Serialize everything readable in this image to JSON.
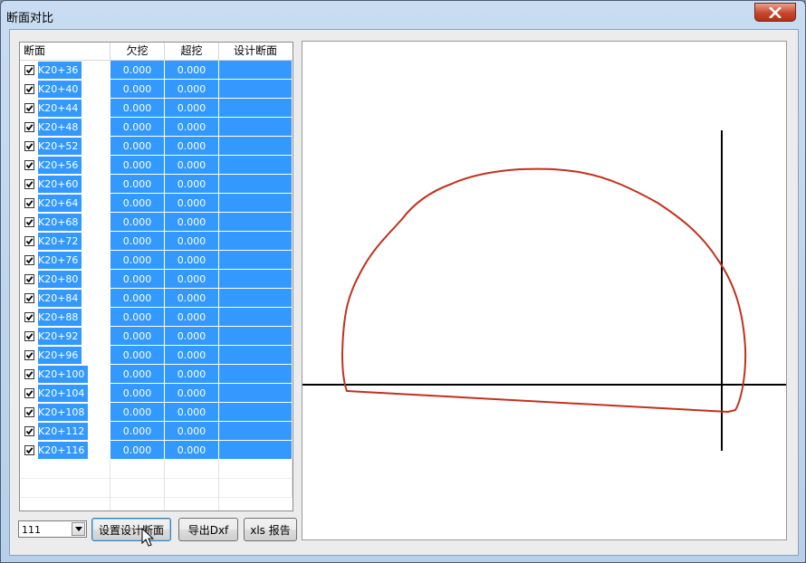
{
  "window": {
    "title": "断面对比"
  },
  "table": {
    "headers": [
      "断面",
      "欠挖",
      "超挖",
      "设计断面"
    ],
    "rows": [
      {
        "station": "K20+36",
        "under": "0.000",
        "over": "0.000",
        "design": "",
        "checked": true
      },
      {
        "station": "K20+40",
        "under": "0.000",
        "over": "0.000",
        "design": "",
        "checked": true
      },
      {
        "station": "K20+44",
        "under": "0.000",
        "over": "0.000",
        "design": "",
        "checked": true
      },
      {
        "station": "K20+48",
        "under": "0.000",
        "over": "0.000",
        "design": "",
        "checked": true
      },
      {
        "station": "K20+52",
        "under": "0.000",
        "over": "0.000",
        "design": "",
        "checked": true
      },
      {
        "station": "K20+56",
        "under": "0.000",
        "over": "0.000",
        "design": "",
        "checked": true
      },
      {
        "station": "K20+60",
        "under": "0.000",
        "over": "0.000",
        "design": "",
        "checked": true
      },
      {
        "station": "K20+64",
        "under": "0.000",
        "over": "0.000",
        "design": "",
        "checked": true
      },
      {
        "station": "K20+68",
        "under": "0.000",
        "over": "0.000",
        "design": "",
        "checked": true
      },
      {
        "station": "K20+72",
        "under": "0.000",
        "over": "0.000",
        "design": "",
        "checked": true
      },
      {
        "station": "K20+76",
        "under": "0.000",
        "over": "0.000",
        "design": "",
        "checked": true
      },
      {
        "station": "K20+80",
        "under": "0.000",
        "over": "0.000",
        "design": "",
        "checked": true
      },
      {
        "station": "K20+84",
        "under": "0.000",
        "over": "0.000",
        "design": "",
        "checked": true
      },
      {
        "station": "K20+88",
        "under": "0.000",
        "over": "0.000",
        "design": "",
        "checked": true
      },
      {
        "station": "K20+92",
        "under": "0.000",
        "over": "0.000",
        "design": "",
        "checked": true
      },
      {
        "station": "K20+96",
        "under": "0.000",
        "over": "0.000",
        "design": "",
        "checked": true
      },
      {
        "station": "K20+100",
        "under": "0.000",
        "over": "0.000",
        "design": "",
        "checked": true
      },
      {
        "station": "K20+104",
        "under": "0.000",
        "over": "0.000",
        "design": "",
        "checked": true
      },
      {
        "station": "K20+108",
        "under": "0.000",
        "over": "0.000",
        "design": "",
        "checked": true
      },
      {
        "station": "K20+112",
        "under": "0.000",
        "over": "0.000",
        "design": "",
        "checked": true
      },
      {
        "station": "K20+116",
        "under": "0.000",
        "over": "0.000",
        "design": "",
        "checked": true
      }
    ]
  },
  "controls": {
    "combo_value": "111",
    "set_design_label": "设置设计断面",
    "export_dxf_label": "导出Dxf",
    "xls_report_label": "xls 报告"
  },
  "colors": {
    "selection": "#3399ff",
    "profile_line": "#c0321e",
    "axis_line": "#000000"
  },
  "icons": [
    "close-icon",
    "checkbox-checked-icon",
    "dropdown-arrow-icon",
    "mouse-cursor-icon"
  ]
}
